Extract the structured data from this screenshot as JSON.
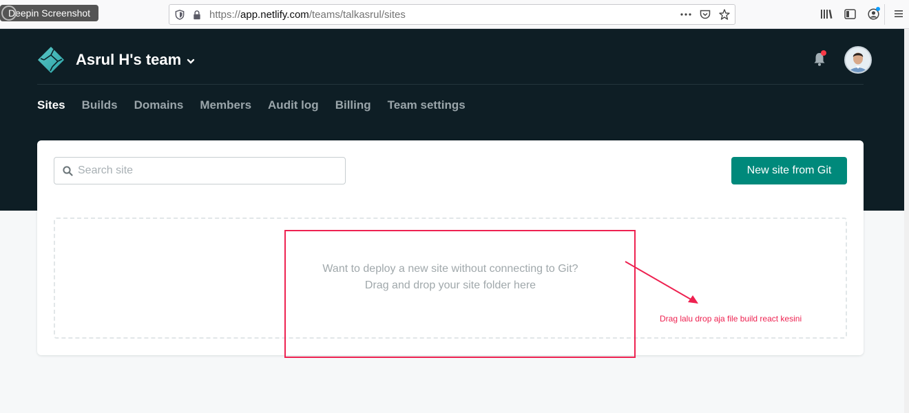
{
  "screenshot_tool": {
    "label": "Deepin Screenshot"
  },
  "browser": {
    "url_prefix": "https://",
    "url_domain": "app.netlify.com",
    "url_path": "/teams/talkasrul/sites",
    "actions_icon_names": [
      "more-actions-icon",
      "pocket-icon",
      "bookmark-star-icon"
    ],
    "toolbar_icon_names": [
      "library-icon",
      "sidebar-icon",
      "account-icon",
      "menu-icon"
    ]
  },
  "header": {
    "team_name": "Asrul H's team",
    "nav": [
      {
        "label": "Sites",
        "active": true
      },
      {
        "label": "Builds",
        "active": false
      },
      {
        "label": "Domains",
        "active": false
      },
      {
        "label": "Members",
        "active": false
      },
      {
        "label": "Audit log",
        "active": false
      },
      {
        "label": "Billing",
        "active": false
      },
      {
        "label": "Team settings",
        "active": false
      }
    ]
  },
  "search": {
    "placeholder": "Search site"
  },
  "actions": {
    "new_site_label": "New site from Git"
  },
  "dropzone": {
    "line1": "Want to deploy a new site without connecting to Git?",
    "line2": "Drag and drop your site folder here"
  },
  "annotation": {
    "text": "Drag lalu drop aja file build react kesini"
  },
  "colors": {
    "header_bg": "#0e1e25",
    "brand_teal": "#00897b",
    "annotation_red": "#ee2150",
    "notification_dot": "#fa3946"
  }
}
